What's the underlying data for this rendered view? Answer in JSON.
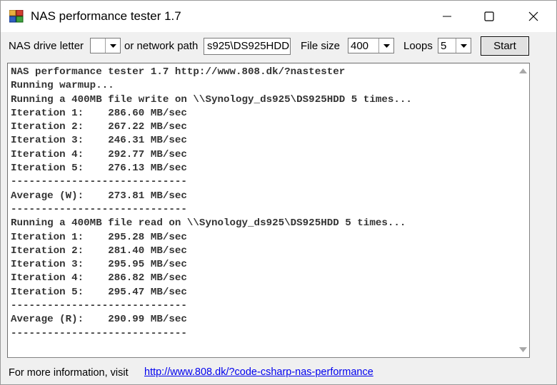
{
  "window": {
    "title": "NAS performance tester 1.7"
  },
  "toolbar": {
    "drive_label": "NAS drive letter",
    "drive_value": "",
    "path_label": "or network path",
    "path_value": "s925\\DS925HDD",
    "filesize_label": "File size",
    "filesize_value": "400",
    "loops_label": "Loops",
    "loops_value": "5",
    "start_label": "Start"
  },
  "output": {
    "lines": [
      "NAS performance tester 1.7 http://www.808.dk/?nastester",
      "Running warmup...",
      "Running a 400MB file write on \\\\Synology_ds925\\DS925HDD 5 times...",
      "Iteration 1:    286.60 MB/sec",
      "Iteration 2:    267.22 MB/sec",
      "Iteration 3:    246.31 MB/sec",
      "Iteration 4:    292.77 MB/sec",
      "Iteration 5:    276.13 MB/sec",
      "-----------------------------",
      "Average (W):    273.81 MB/sec",
      "-----------------------------",
      "Running a 400MB file read on \\\\Synology_ds925\\DS925HDD 5 times...",
      "Iteration 1:    295.28 MB/sec",
      "Iteration 2:    281.40 MB/sec",
      "Iteration 3:    295.95 MB/sec",
      "Iteration 4:    286.82 MB/sec",
      "Iteration 5:    295.47 MB/sec",
      "-----------------------------",
      "Average (R):    290.99 MB/sec",
      "-----------------------------"
    ]
  },
  "footer": {
    "info_label": "For more information, visit",
    "link_text": "http://www.808.dk/?code-csharp-nas-performance"
  },
  "icons": {
    "app": "app-icon",
    "minimize": "minimize-icon",
    "maximize": "maximize-icon",
    "close": "close-icon",
    "dropdown": "chevron-down-icon",
    "scroll_up": "scroll-up-icon",
    "scroll_down": "scroll-down-icon"
  },
  "colors": {
    "link": "#0000ee",
    "window_bg": "#f0f0f0"
  }
}
